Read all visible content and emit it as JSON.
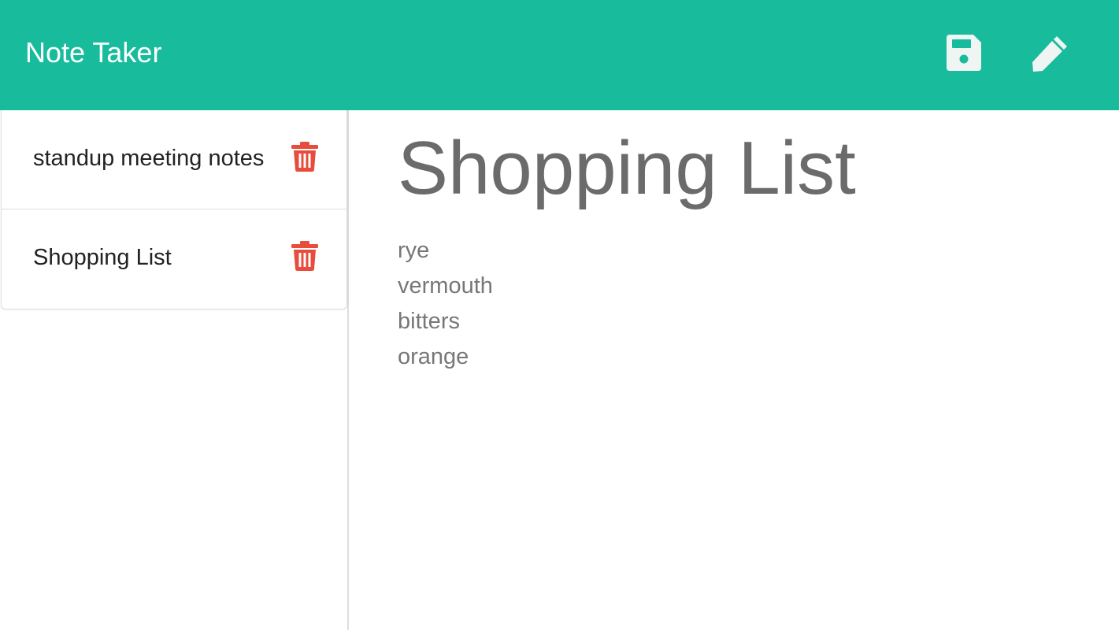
{
  "app": {
    "title": "Note Taker",
    "accent_color": "#18bc9c",
    "danger_color": "#e74c3c"
  },
  "toolbar": {
    "save_icon": "floppy-disk-icon",
    "new_icon": "pencil-icon"
  },
  "sidebar": {
    "notes": [
      {
        "title": "standup meeting notes",
        "delete_icon": "trash-icon"
      },
      {
        "title": "Shopping List",
        "delete_icon": "trash-icon"
      }
    ]
  },
  "editor": {
    "title": "Shopping List",
    "lines": [
      "rye",
      "vermouth",
      "bitters",
      "orange"
    ]
  }
}
